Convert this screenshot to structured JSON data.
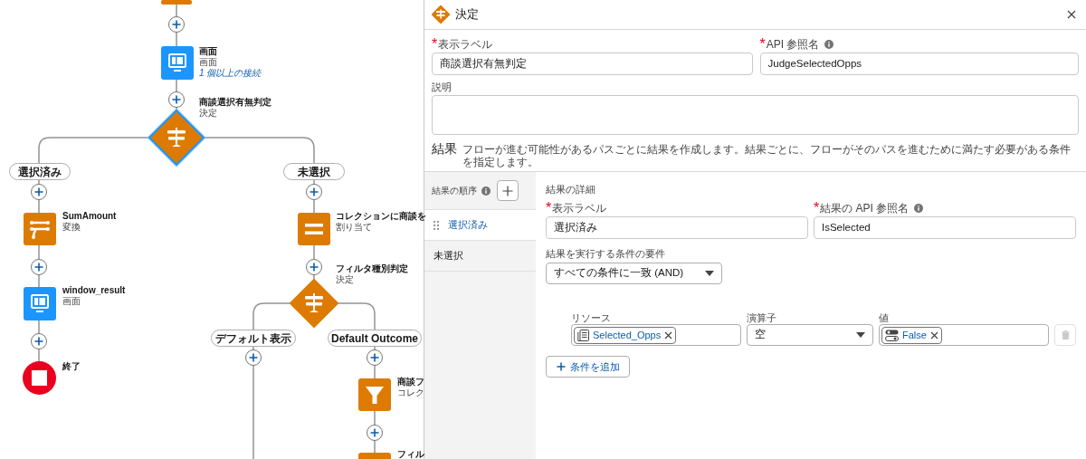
{
  "flow": {
    "nodes": [
      {
        "kind": "partial",
        "selected": false
      },
      {
        "kind": "screen",
        "title": "画面",
        "subtitle": "画面",
        "note": "1 個以上の接続",
        "selected": false
      },
      {
        "kind": "decision",
        "title": "商談選択有無判定",
        "subtitle": "決定",
        "selected": true
      },
      {
        "kind": "transform",
        "title": "SumAmount",
        "subtitle": "変換",
        "selected": false
      },
      {
        "kind": "screen",
        "title": "window_result",
        "subtitle": "画面",
        "selected": false
      },
      {
        "kind": "end",
        "title": "終了",
        "selected": false
      },
      {
        "kind": "assignment",
        "title": "コレクションに商談を",
        "subtitle": "割り当て",
        "selected": false
      },
      {
        "kind": "decision",
        "title": "フィルタ種別判定",
        "subtitle": "決定",
        "selected": false
      },
      {
        "kind": "filter",
        "title": "商談フ",
        "subtitle": "コレク",
        "selected": false
      },
      {
        "kind": "filter_partial",
        "title": "フィル",
        "selected": false
      }
    ],
    "outcome_labels": [
      "選択済み",
      "未選択",
      "デフォルト表示",
      "Default Outcome"
    ]
  },
  "panel": {
    "title": "決定",
    "label_field": {
      "label": "表示ラベル",
      "required_mark": "*",
      "value": "商談選択有無判定"
    },
    "api_field": {
      "label": "API 参照名",
      "required_mark": "*",
      "value": "JudgeSelectedOpps"
    },
    "description_field": {
      "label": "説明"
    },
    "outcomes": {
      "title": "結果",
      "description": "フローが進む可能性があるパスごとに結果を作成します。結果ごとに、フローがそのパスを進むために満たす必要がある条件を指定します。"
    },
    "outcome_order": {
      "label": "結果の順序",
      "items": [
        {
          "label": "選択済み",
          "selected": true
        },
        {
          "label": "未選択",
          "selected": false
        }
      ]
    },
    "details": {
      "title": "結果の詳細",
      "label_field": {
        "label": "表示ラベル",
        "required_mark": "*",
        "value": "選択済み"
      },
      "api_field": {
        "label": "結果の API 参照名",
        "required_mark": "*",
        "value": "IsSelected"
      },
      "requirement": {
        "label": "結果を実行する条件の要件",
        "value": "すべての条件に一致 (AND)"
      },
      "condition_columns": [
        "リソース",
        "演算子",
        "値"
      ],
      "conditions": [
        {
          "resource": "Selected_Opps",
          "operator": "空",
          "value": "False"
        }
      ],
      "add_condition": "条件を追加"
    }
  }
}
